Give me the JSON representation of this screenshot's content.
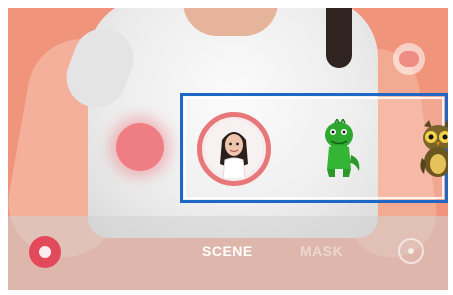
{
  "modes": {
    "items": [
      "SCENE",
      "MASK"
    ],
    "selected": "SCENE"
  },
  "emoji_strip": {
    "items": [
      {
        "icon": "my-emoji-avatar-icon",
        "selected": true
      },
      {
        "icon": "green-dinosaur-emoji-icon",
        "selected": false
      },
      {
        "icon": "owl-emoji-icon",
        "selected": false
      }
    ]
  },
  "colors": {
    "highlight_border": "#1e67c7",
    "selected_ring": "#e87779",
    "background": "#f0947c",
    "record_button": "#e24a5c"
  }
}
